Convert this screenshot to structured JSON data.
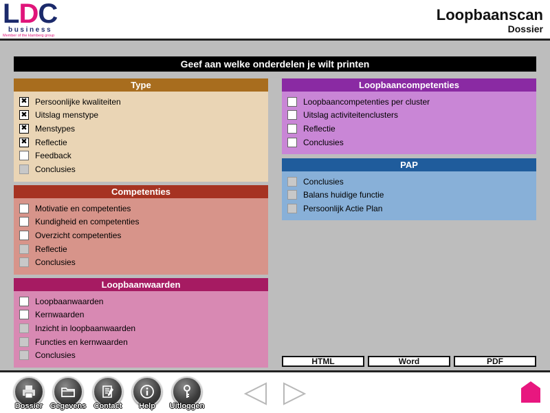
{
  "header": {
    "logo": {
      "text_prefix": "L",
      "text_d": "D",
      "text_suffix": "C",
      "sub": "business",
      "member": "Member of the klamberg group"
    },
    "title": "Loopbaanscan",
    "subtitle": "Dossier"
  },
  "main": {
    "instruction": "Geef aan welke onderdelen je wilt printen",
    "panels": {
      "type": {
        "title": "Type",
        "color": "#a86d1e",
        "items": [
          {
            "label": "Persoonlijke kwaliteiten",
            "checked": true,
            "enabled": true
          },
          {
            "label": "Uitslag menstype",
            "checked": true,
            "enabled": true
          },
          {
            "label": "Menstypes",
            "checked": true,
            "enabled": true
          },
          {
            "label": "Reflectie",
            "checked": true,
            "enabled": true
          },
          {
            "label": "Feedback",
            "checked": false,
            "enabled": true
          },
          {
            "label": "Conclusies",
            "checked": false,
            "enabled": false
          }
        ]
      },
      "competenties": {
        "title": "Competenties",
        "color": "#a63322",
        "items": [
          {
            "label": "Motivatie en competenties",
            "checked": false,
            "enabled": true
          },
          {
            "label": "Kundigheid en competenties",
            "checked": false,
            "enabled": true
          },
          {
            "label": "Overzicht competenties",
            "checked": false,
            "enabled": true
          },
          {
            "label": "Reflectie",
            "checked": false,
            "enabled": false
          },
          {
            "label": "Conclusies",
            "checked": false,
            "enabled": false
          }
        ]
      },
      "loopbaanwaarden": {
        "title": "Loopbaanwaarden",
        "color": "#a61b62",
        "items": [
          {
            "label": "Loopbaanwaarden",
            "checked": false,
            "enabled": true
          },
          {
            "label": "Kernwaarden",
            "checked": false,
            "enabled": true
          },
          {
            "label": "Inzicht in loopbaanwaarden",
            "checked": false,
            "enabled": false
          },
          {
            "label": "Functies en kernwaarden",
            "checked": false,
            "enabled": false
          },
          {
            "label": "Conclusies",
            "checked": false,
            "enabled": false
          }
        ]
      },
      "loopbaancompetenties": {
        "title": "Loopbaancompetenties",
        "color": "#8a2aa3",
        "items": [
          {
            "label": "Loopbaancompetenties per cluster",
            "checked": false,
            "enabled": true
          },
          {
            "label": "Uitslag activiteitenclusters",
            "checked": false,
            "enabled": true
          },
          {
            "label": "Reflectie",
            "checked": false,
            "enabled": true
          },
          {
            "label": "Conclusies",
            "checked": false,
            "enabled": true
          }
        ]
      },
      "pap": {
        "title": "PAP",
        "color": "#1f5c9c",
        "items": [
          {
            "label": "Conclusies",
            "checked": false,
            "enabled": false
          },
          {
            "label": "Balans huidige functie",
            "checked": false,
            "enabled": false
          },
          {
            "label": "Persoonlijk Actie Plan",
            "checked": false,
            "enabled": false
          }
        ]
      }
    },
    "export": {
      "html": "HTML",
      "word": "Word",
      "pdf": "PDF"
    }
  },
  "footer": {
    "nav": [
      {
        "label": "Dossier",
        "icon": "printer-icon"
      },
      {
        "label": "Gegevens",
        "icon": "folder-icon"
      },
      {
        "label": "Contact",
        "icon": "contact-card-icon"
      },
      {
        "label": "Help",
        "icon": "info-icon"
      },
      {
        "label": "Uitloggen",
        "icon": "key-icon"
      }
    ],
    "home_color": "#e8177f"
  }
}
